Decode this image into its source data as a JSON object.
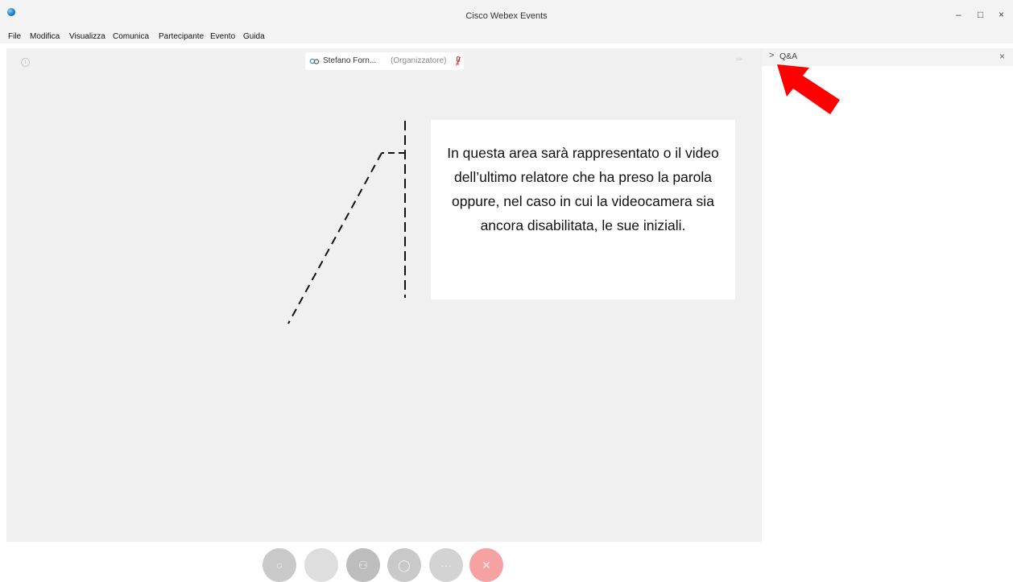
{
  "window": {
    "title": "Cisco Webex Events",
    "minimize_glyph": "–",
    "maximize_glyph": "□",
    "close_glyph": "×"
  },
  "menu": {
    "items": [
      {
        "label": "File"
      },
      {
        "label": "Modifica"
      },
      {
        "label": "Visualizza"
      },
      {
        "label": "Comunica"
      },
      {
        "label": "Partecipante"
      },
      {
        "label": "Evento"
      },
      {
        "label": "Guida"
      }
    ]
  },
  "stage": {
    "speaker_name": "Stefano Forn...",
    "speaker_role": "(Organizzatore)",
    "annotation_text": "In questa area sarà rappresentato o il video dell’ultimo relatore che ha preso la parola oppure, nel caso in cui la videocamera sia ancora disabilitata, le sue iniziali."
  },
  "controls": [
    {
      "name": "mute-button",
      "icon": "microphone-icon",
      "color": "#c9c9c9",
      "glyph": "○"
    },
    {
      "name": "video-button",
      "icon": "camera-icon",
      "color": "#dedede",
      "glyph": ""
    },
    {
      "name": "participants-button",
      "icon": "participants-icon",
      "color": "#bdbdbd",
      "glyph": "⚇"
    },
    {
      "name": "chat-button",
      "icon": "chat-icon",
      "color": "#c9c9c9",
      "glyph": "◯"
    },
    {
      "name": "more-button",
      "icon": "more-icon",
      "color": "#d3d3d3",
      "glyph": "···"
    },
    {
      "name": "leave-button",
      "icon": "close-icon",
      "color": "#f6a2a2",
      "glyph": "✕"
    }
  ],
  "panel": {
    "chevron": ">",
    "title": "Q&A",
    "close": "×"
  },
  "colors": {
    "stage_bg": "#f0f0f0",
    "annotation_arrow": "#ff0000"
  }
}
